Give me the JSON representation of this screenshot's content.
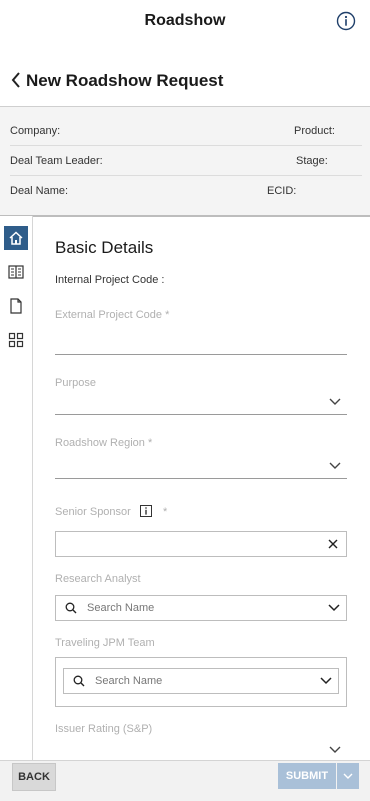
{
  "app_title": "Roadshow",
  "page_heading": "New Roadshow Request",
  "summary": {
    "company_label": "Company:",
    "product_label": "Product:",
    "deal_team_leader_label": "Deal Team Leader:",
    "stage_label": "Stage:",
    "deal_name_label": "Deal Name:",
    "ecid_label": "ECID:"
  },
  "rail": [
    {
      "icon": "home-icon",
      "active": true
    },
    {
      "icon": "book-icon",
      "active": false
    },
    {
      "icon": "document-icon",
      "active": false
    },
    {
      "icon": "grid-icon",
      "active": false
    }
  ],
  "section_title": "Basic Details",
  "fields": {
    "internal_project_code": "Internal Project Code :",
    "external_project_code": "External Project Code",
    "purpose": "Purpose",
    "roadshow_region": "Roadshow Region",
    "senior_sponsor": "Senior Sponsor",
    "research_analyst": "Research Analyst",
    "research_analyst_placeholder": "Search Name",
    "traveling_team": "Traveling JPM Team",
    "traveling_team_placeholder": "Search Name",
    "issuer_rating": "Issuer Rating (S&P)"
  },
  "required_marker": "*",
  "buttons": {
    "back": "BACK",
    "submit": "SUBMIT"
  },
  "colors": {
    "accent": "#2f5d8a",
    "submit_disabled": "#a9c0d8"
  }
}
